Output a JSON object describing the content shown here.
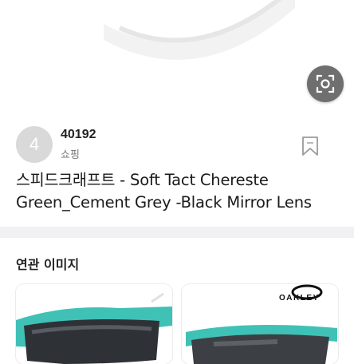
{
  "source": {
    "badge": "4",
    "name": "40192",
    "category": "쇼핑"
  },
  "title": "스피드크래프트 - Soft Tact Chereste Green_Cement Grey -Black Mirror Lens",
  "related": {
    "heading": "연관 이미지",
    "items": [
      {
        "brand": ""
      },
      {
        "brand": "OAKLEY"
      }
    ]
  },
  "icons": {
    "lens": "image-search-icon",
    "bookmark": "bookmark-icon"
  },
  "colors": {
    "frame_green": "#3fc1b6",
    "lens_dark": "#3c3f44",
    "divider": "#f1f1f3"
  }
}
